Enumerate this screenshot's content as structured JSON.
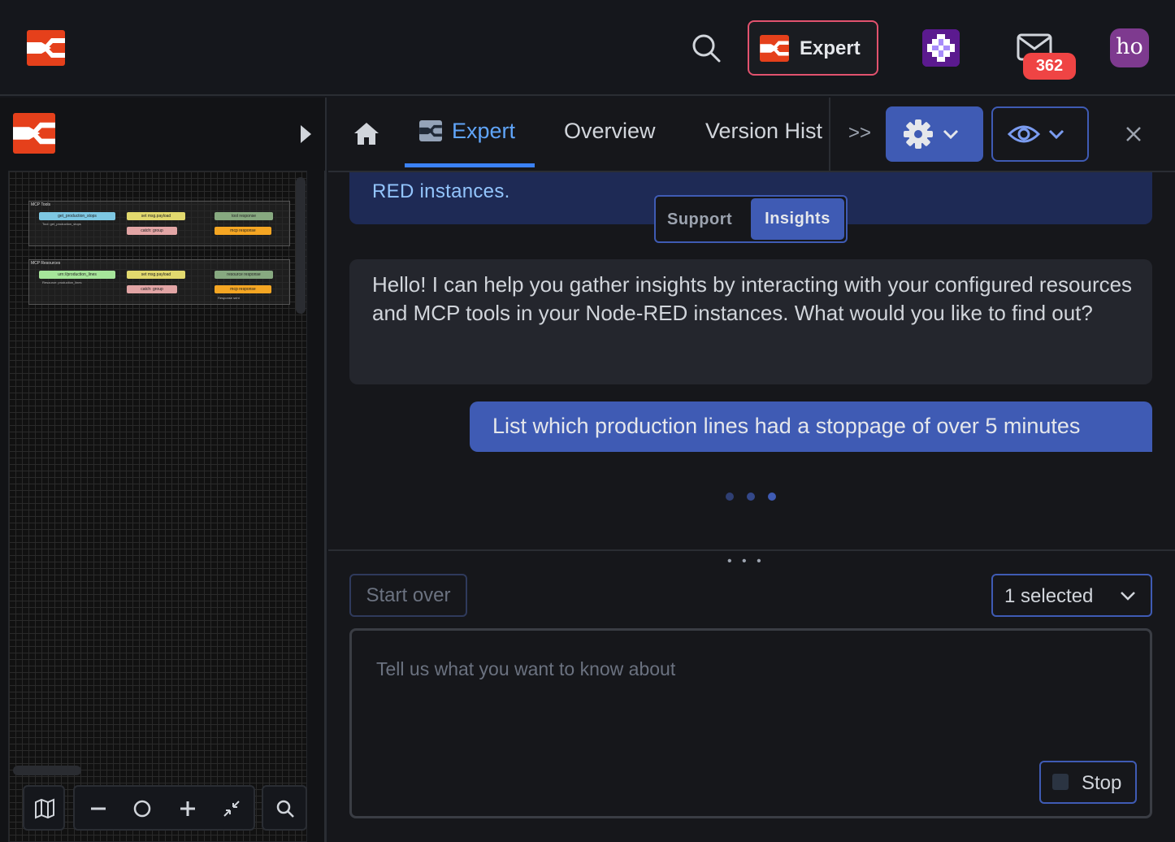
{
  "header": {
    "expert_button_label": "Expert",
    "notifications_count": "362",
    "avatar_initials": "ho"
  },
  "canvas": {
    "flows": [
      {
        "title": "MCP Tools",
        "nodes": [
          "get_production_stops",
          "set msg.payload",
          "tool response",
          "catch: group",
          "mcp response"
        ],
        "sub_label": "Tool: get_production_stops"
      },
      {
        "title": "MCP Resources",
        "nodes": [
          "urn://production_lines",
          "set msg.payload",
          "resource response",
          "catch: group",
          "mcp response"
        ],
        "sub_label": "Resource: production_lines",
        "status": "Response sent"
      }
    ]
  },
  "tabs": {
    "items": [
      "Expert",
      "Overview",
      "Version Hist"
    ],
    "active": "Expert",
    "more": ">>"
  },
  "chat": {
    "previous_tail": "RED instances.",
    "mode_support": "Support",
    "mode_insights": "Insights",
    "assistant_message": "Hello! I can help you gather insights by interacting with your configured resources and MCP tools in your Node-RED instances. What would you like to find out?",
    "user_message": "List which production lines had a stoppage of over 5 minutes"
  },
  "composer": {
    "start_over": "Start over",
    "selector_value": "1 selected",
    "placeholder": "Tell us what you want to know about",
    "stop_label": "Stop",
    "resize_handle": "• • •"
  },
  "colors": {
    "brand": "#e5401b",
    "accent": "#3f5bb4",
    "badge": "#ef4444",
    "avatar": "#7e3a8f"
  }
}
